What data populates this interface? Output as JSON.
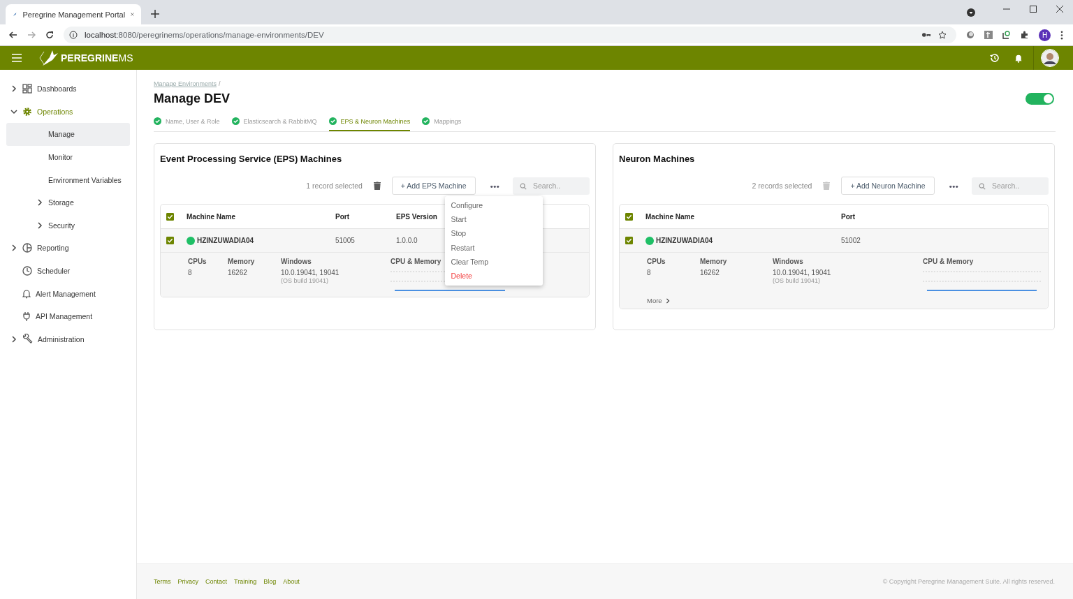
{
  "browser": {
    "tab_title": "Peregrine Management Portal",
    "url_host": "localhost",
    "url_rest": ":8080/peregrinems/operations/manage-environments/DEV",
    "profile_initial": "H"
  },
  "header": {
    "brand_main": "PEREGRINE",
    "brand_suffix": "MS"
  },
  "sidebar": {
    "items": [
      {
        "label": "Dashboards",
        "expanded": false,
        "selected": false
      },
      {
        "label": "Operations",
        "expanded": true,
        "selected": true,
        "children": [
          {
            "label": "Manage",
            "selected": true
          },
          {
            "label": "Monitor",
            "selected": false
          },
          {
            "label": "Environment Variables",
            "selected": false
          },
          {
            "label": "Storage",
            "expanded": false,
            "selected": false
          },
          {
            "label": "Security",
            "expanded": false,
            "selected": false
          }
        ]
      },
      {
        "label": "Reporting",
        "expanded": false,
        "selected": false
      },
      {
        "label": "Scheduler",
        "selected": false
      },
      {
        "label": "Alert Management",
        "selected": false
      },
      {
        "label": "API Management",
        "selected": false
      },
      {
        "label": "Administration",
        "expanded": false,
        "selected": false
      }
    ]
  },
  "breadcrumb": [
    "Manage Environments",
    "/"
  ],
  "title": "Manage DEV",
  "enabled_toggle": {
    "on": true
  },
  "steps": [
    {
      "label": "Name, User & Role",
      "done": true,
      "selected": false
    },
    {
      "label": "Elasticsearch & RabbitMQ",
      "done": true,
      "selected": false
    },
    {
      "label": "EPS & Neuron Machines",
      "done": true,
      "selected": true
    },
    {
      "label": "Mappings",
      "done": true,
      "selected": false
    }
  ],
  "panels": [
    {
      "title": "Event Processing Service (EPS) Machines",
      "selection_text": "1 record selected",
      "delete_disabled": false,
      "add_label": "+ Add EPS Machine",
      "more_label": "•••",
      "search_placeholder": "Search..",
      "header_checked": true,
      "columns": [
        "Machine Name",
        "Port",
        "EPS Version"
      ],
      "rows": [
        {
          "checked": true,
          "color": "#1fbf66",
          "cells": [
            "HZINZUWADIA04",
            "51005",
            "1.0.0.0"
          ],
          "details": [
            {
              "label": "CPUs",
              "value": "8"
            },
            {
              "label": "Memory",
              "value": "16262"
            },
            {
              "label": "Windows",
              "value": "10.0.19041, 19041",
              "note": "(OS build 19041)"
            }
          ],
          "chart_label": "CPU & Memory"
        }
      ],
      "menu": [
        {
          "label": "Configure",
          "kind": "normal"
        },
        {
          "label": "Start",
          "kind": "normal"
        },
        {
          "label": "Stop",
          "kind": "normal"
        },
        {
          "label": "Restart",
          "kind": "normal"
        },
        {
          "label": "Clear Temp",
          "kind": "normal"
        },
        {
          "label": "Delete",
          "kind": "danger"
        }
      ]
    },
    {
      "title": "Neuron Machines",
      "selection_text": "2 records selected",
      "delete_disabled": true,
      "add_label": "+ Add Neuron Machine",
      "more_label": "•••",
      "search_placeholder": "Search..",
      "header_checked": true,
      "columns": [
        "Machine Name",
        "Port"
      ],
      "rows": [
        {
          "checked": true,
          "color": "#1fbf66",
          "cells": [
            "HZINZUWADIA04",
            "51002"
          ],
          "details": [
            {
              "label": "CPUs",
              "value": "8"
            },
            {
              "label": "Memory",
              "value": "16262"
            },
            {
              "label": "Windows",
              "value": "10.0.19041, 19041",
              "note": "(OS build 19041)"
            }
          ],
          "chart_label": "CPU & Memory",
          "more_link": "More"
        }
      ]
    }
  ],
  "footer": {
    "links": [
      "Terms",
      "Privacy",
      "Contact",
      "Training",
      "Blog",
      "About"
    ],
    "copyright": "© Copyright Peregrine Management Suite. All rights reserved."
  }
}
